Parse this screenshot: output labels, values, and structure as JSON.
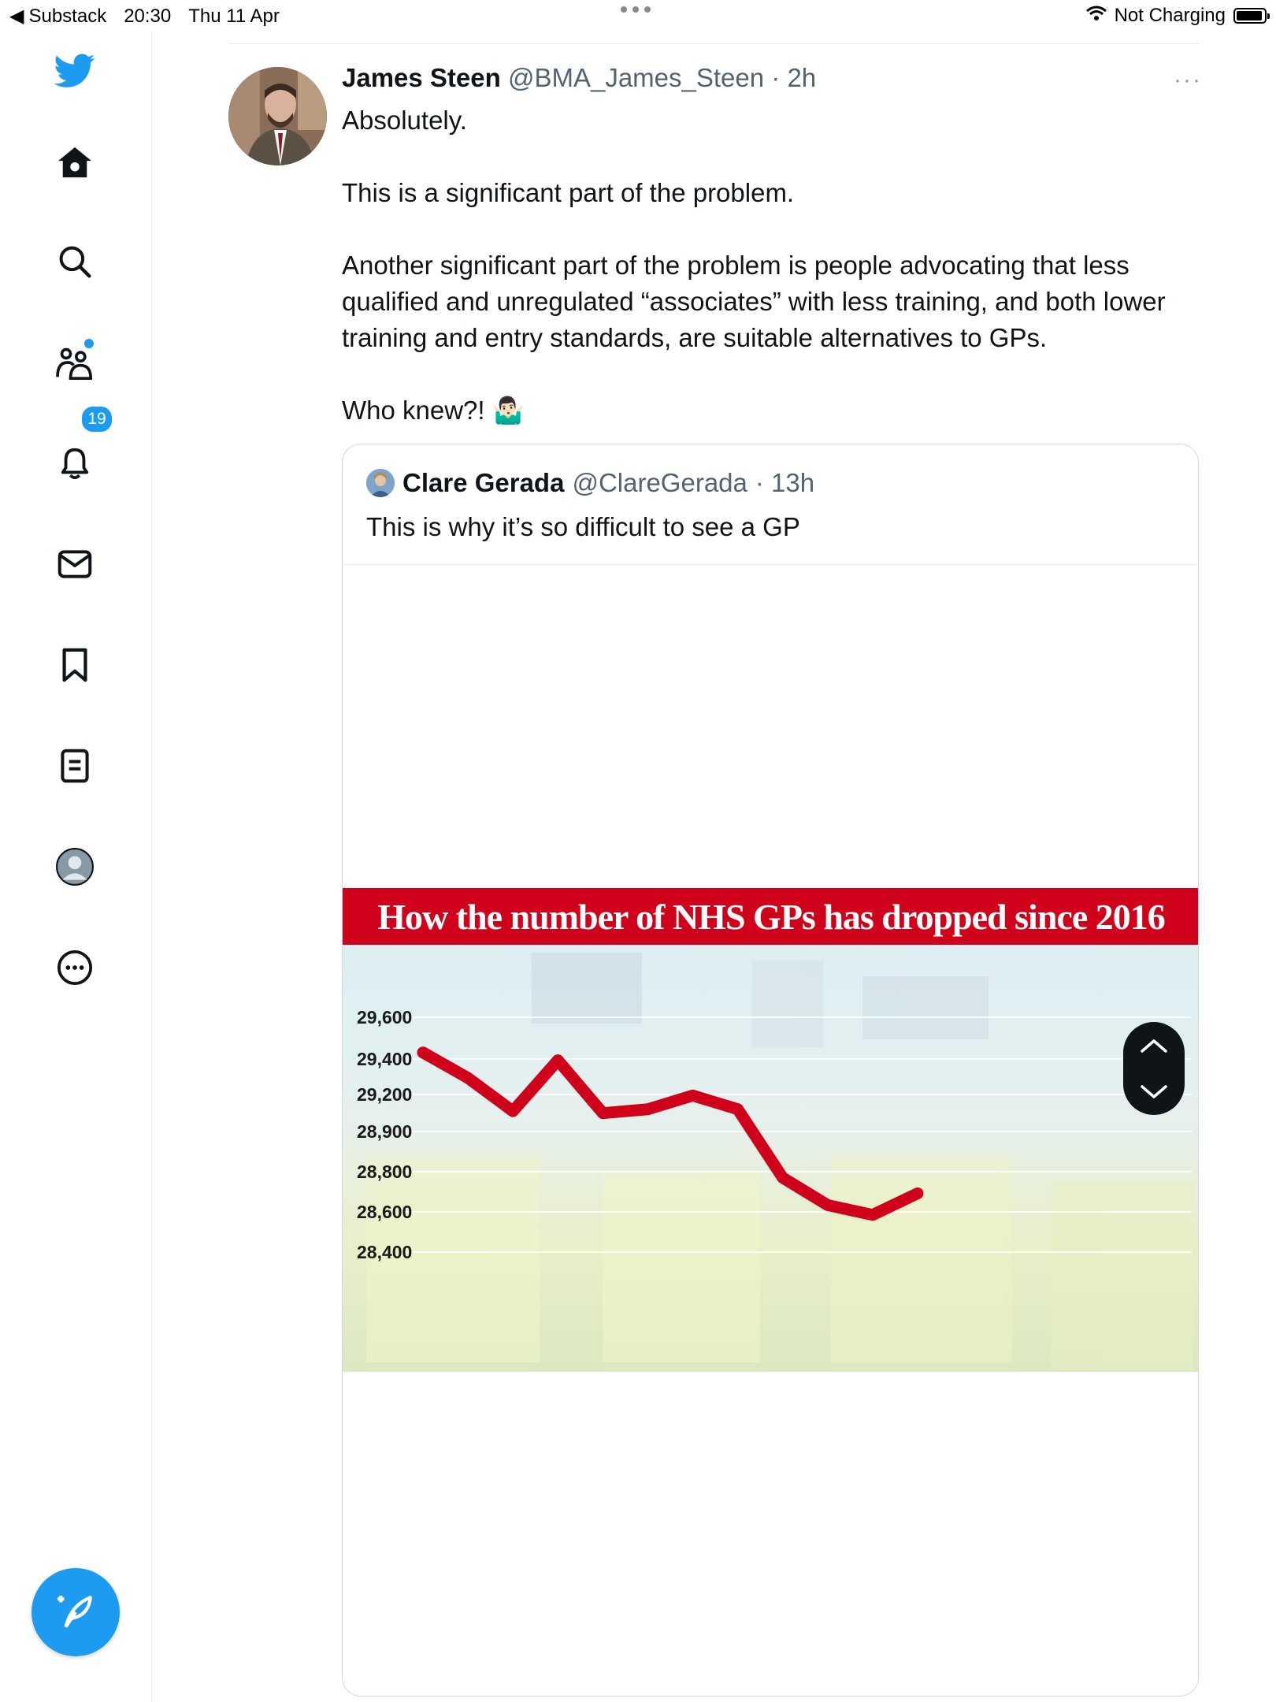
{
  "status_bar": {
    "back_app": "Substack",
    "time": "20:30",
    "date": "Thu 11 Apr",
    "charging": "Not Charging"
  },
  "sidebar": {
    "notifications_count": "19",
    "accent": "#1d9bf0"
  },
  "tweet": {
    "author_name": "James Steen",
    "handle": "@BMA_James_Steen",
    "time": "· 2h",
    "more": "···",
    "paragraphs": [
      "Absolutely.",
      "This is a significant part of the problem.",
      "Another significant part of the problem is people advocating that less qualified and unregulated “associates” with less training, and both lower training and entry standards, are suitable alternatives to GPs.",
      "Who knew?! 🤷🏻‍♂️"
    ]
  },
  "quote": {
    "author_name": "Clare Gerada",
    "handle": "@ClareGerada",
    "time": "· 13h",
    "text": "This is why it’s so difficult to see a GP"
  },
  "chart_data": {
    "type": "line",
    "title": "How the number of NHS GPs has dropped since 2016",
    "y_tick_labels": [
      "29,600",
      "29,400",
      "29,200",
      "28,900",
      "28,800",
      "28,600",
      "28,400"
    ],
    "ylim": [
      28400,
      29600
    ],
    "grid": true,
    "line_color": "#d0021b",
    "series": [
      {
        "values": [
          29420,
          29290,
          29120,
          29380,
          29110,
          29130,
          29200,
          29130,
          28780,
          28640,
          28590,
          28700
        ]
      }
    ]
  }
}
